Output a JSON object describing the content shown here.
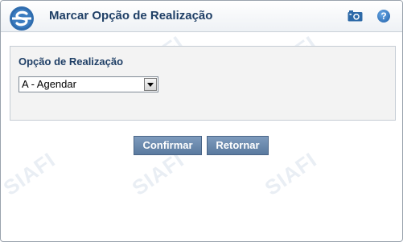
{
  "window": {
    "title": "Marcar Opção de Realização",
    "logo_icon": "siafi-logo-icon",
    "camera_icon": "camera-icon",
    "help_symbol": "?"
  },
  "form": {
    "label": "Opção de Realização",
    "select_value": "A - Agendar"
  },
  "buttons": {
    "confirm": "Confirmar",
    "return": "Retornar"
  },
  "watermark_text": "SIAFI",
  "colors": {
    "title": "#1f3f66",
    "button": "#6a89ae",
    "panel_bg": "#f3f3f3",
    "watermark": "#e9eef4"
  }
}
